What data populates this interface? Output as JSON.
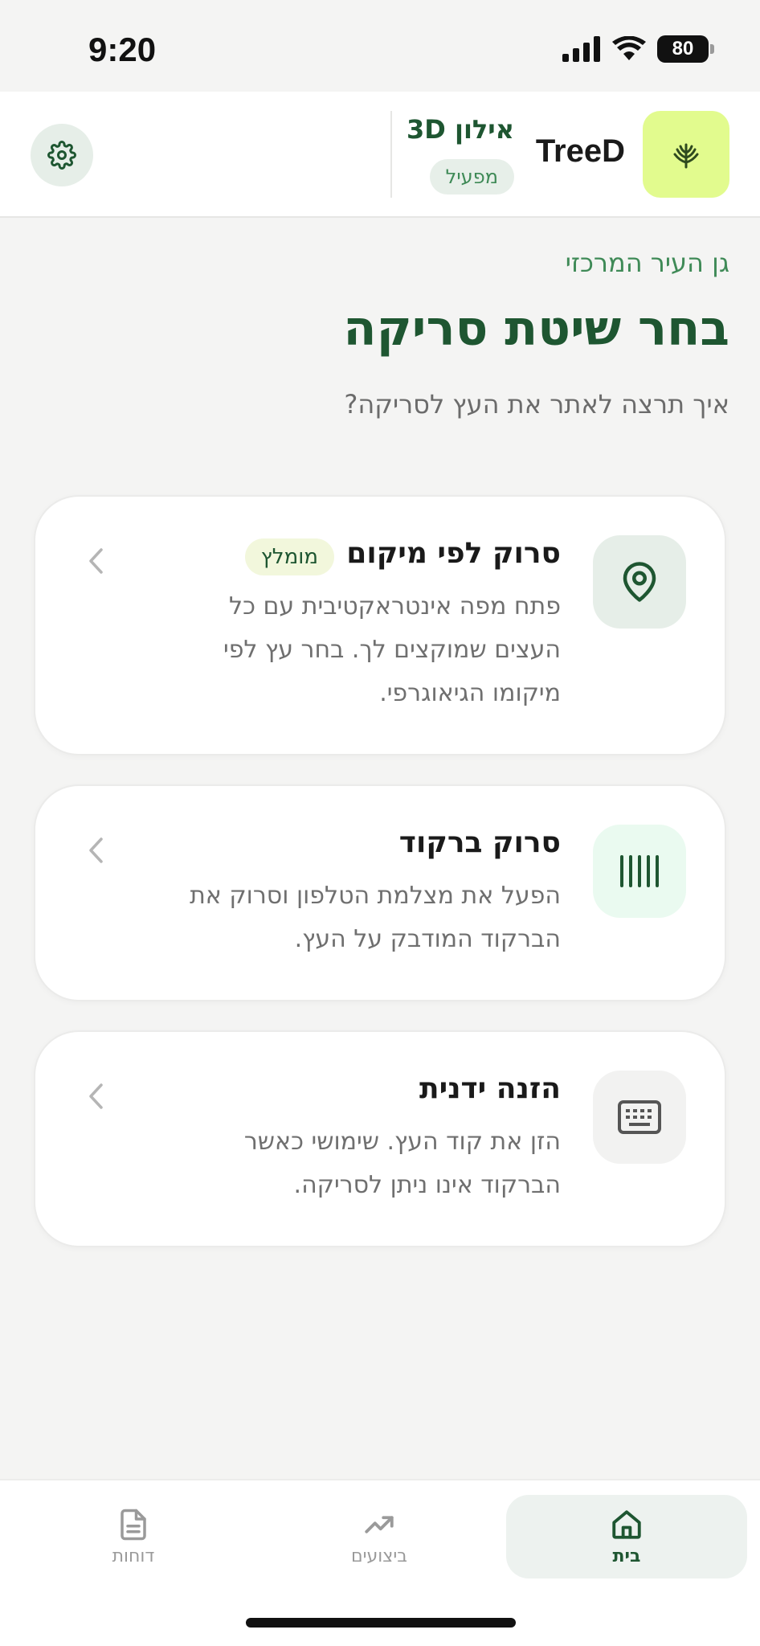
{
  "status_bar": {
    "time": "9:20",
    "battery": "80"
  },
  "header": {
    "brand": "TreeD",
    "user_name": "אילון 3D",
    "user_status": "מפעיל"
  },
  "page": {
    "location": "גן העיר המרכזי",
    "title": "בחר שיטת סריקה",
    "subtitle": "איך תרצה לאתר את העץ לסריקה?"
  },
  "cards": [
    {
      "title": "סרוק לפי מיקום",
      "badge": "מומלץ",
      "description": "פתח מפה אינטראקטיבית עם כל העצים שמוקצים לך. בחר עץ לפי מיקומו הגיאוגרפי.",
      "icon": "map-pin-icon",
      "icon_bg": "#e6eee8"
    },
    {
      "title": "סרוק ברקוד",
      "description": "הפעל את מצלמת הטלפון וסרוק את הברקוד המודבק על העץ.",
      "icon": "barcode-icon",
      "icon_bg": "#eafaf0"
    },
    {
      "title": "הזנה ידנית",
      "description": "הזן את קוד העץ. שימושי כאשר הברקוד אינו ניתן לסריקה.",
      "icon": "keyboard-icon",
      "icon_bg": "#f2f2f1"
    }
  ],
  "nav": {
    "home": "בית",
    "performance": "ביצועים",
    "reports": "דוחות"
  },
  "colors": {
    "primary": "#1e5631",
    "accent": "#3f8a57",
    "logo_bg": "#e2fb8e"
  }
}
